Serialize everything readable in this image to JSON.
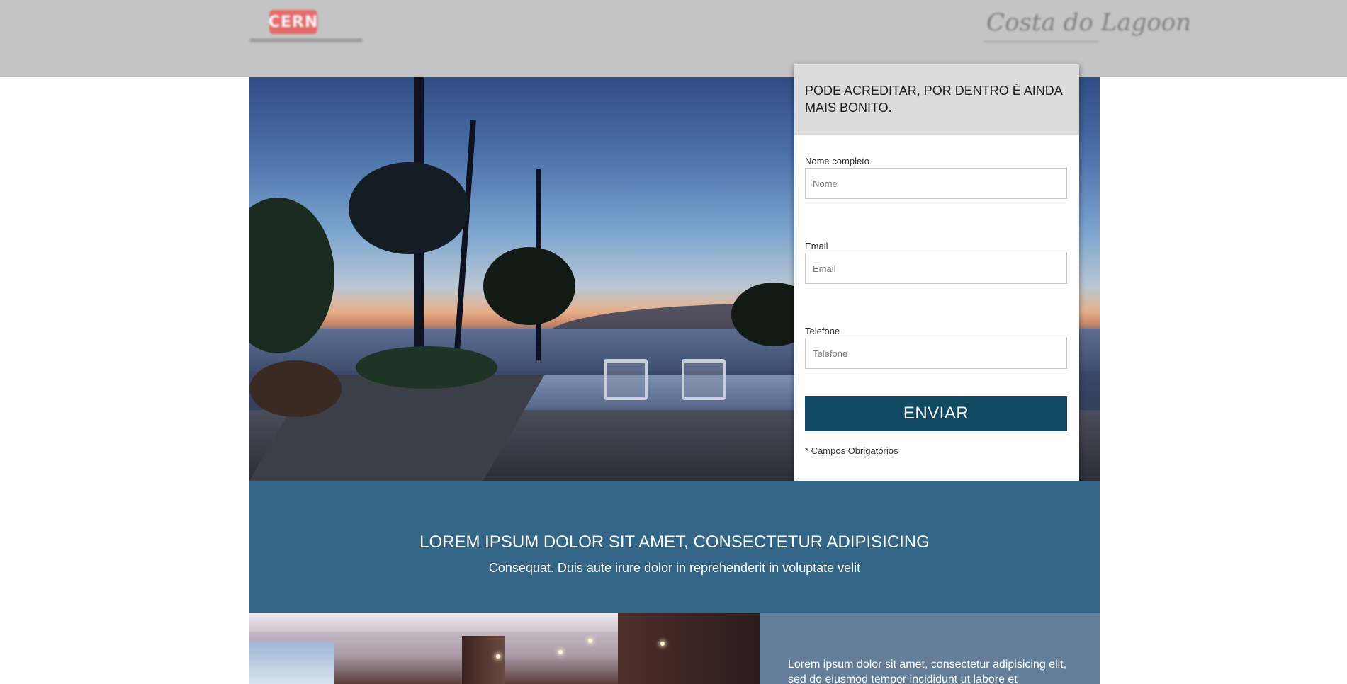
{
  "header": {
    "logo_left": {
      "brand": "CERN",
      "tagline": ""
    },
    "logo_right": {
      "script": "Costa do Lagoon"
    }
  },
  "form": {
    "title": "PODE ACREDITAR, POR DENTRO É AINDA MAIS BONITO.",
    "fields": [
      {
        "label": "Nome completo",
        "placeholder": "Nome"
      },
      {
        "label": "Email",
        "placeholder": "Email"
      },
      {
        "label": "Telefone",
        "placeholder": "Telefone"
      }
    ],
    "submit_label": "ENVIAR",
    "required_note": "* Campos Obrigatórios"
  },
  "band": {
    "heading": "LOREM IPSUM DOLOR SIT AMET, CONSECTETUR ADIPISICING",
    "subheading": "Consequat. Duis aute irure dolor in reprehenderit in voluptate velit"
  },
  "feature": {
    "text": "Lorem ipsum dolor sit amet, consectetur adipisicing elit, sed do eiusmod tempor incididunt ut labore et"
  },
  "colors": {
    "topbar": "#c4c4c4",
    "band": "#336587",
    "button": "#0f4a62",
    "side_panel": "#627e98"
  }
}
